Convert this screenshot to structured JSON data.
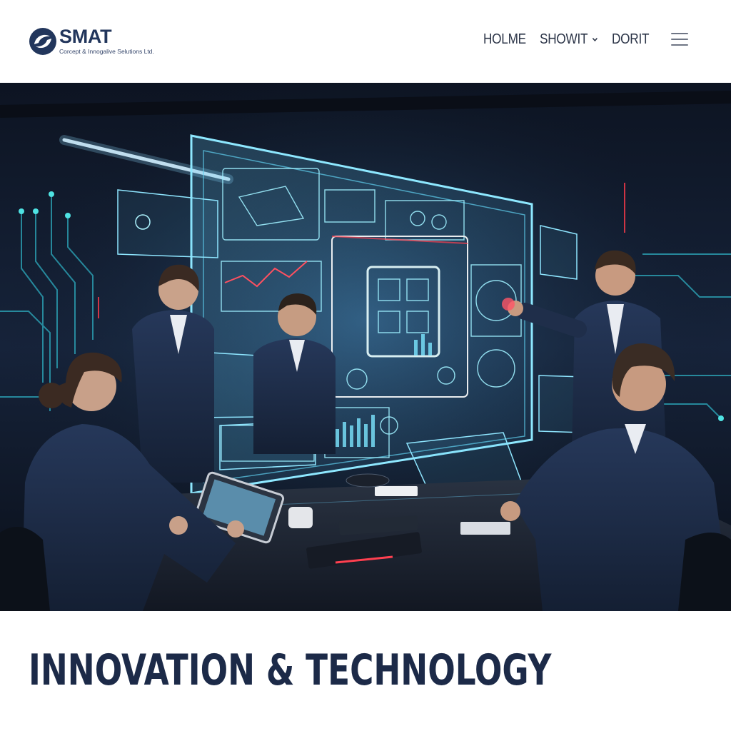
{
  "brand": {
    "name": "SMAT",
    "tagline": "Corcept & Innogalive Selutions Ltd.",
    "logo_icon": "swirl-logo-icon",
    "primary_color": "#22365c"
  },
  "nav": {
    "items": [
      {
        "label": "HOLME"
      },
      {
        "label": "SHOWIT",
        "has_dropdown": true
      },
      {
        "label": "DORIT"
      }
    ],
    "menu_icon": "hamburger-menu-icon"
  },
  "hero": {
    "image": "team-around-holographic-display"
  },
  "page": {
    "title": "INNOVATION & TECHNOLOGY"
  }
}
